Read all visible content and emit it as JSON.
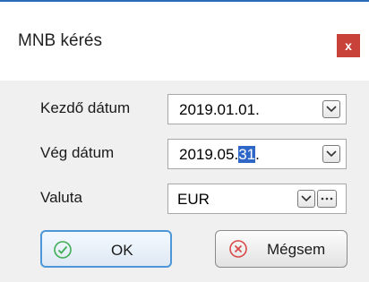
{
  "dialog": {
    "title": "MNB kérés",
    "close_label": "x"
  },
  "form": {
    "start_date_label": "Kezdő dátum",
    "start_date_value": "2019.01.01.",
    "end_date_label": "Vég dátum",
    "end_date_value_prefix": "2019.05.",
    "end_date_value_selected": "31",
    "end_date_value_suffix": ".",
    "currency_label": "Valuta",
    "currency_value": "EUR"
  },
  "buttons": {
    "ok_label": "OK",
    "cancel_label": "Mégsem"
  },
  "colors": {
    "title_border": "#2b6cb7",
    "close_bg": "#c8423a",
    "selection_bg": "#2f67c8",
    "ok_icon": "#3fae55",
    "cancel_icon": "#d84a4a"
  },
  "icons": {
    "start_dropdown": "chevron-down-icon",
    "end_dropdown": "chevron-down-icon",
    "currency_dropdown": "chevron-down-icon",
    "currency_browse": "ellipsis-icon",
    "ok": "check-circle-icon",
    "cancel": "x-circle-icon"
  }
}
